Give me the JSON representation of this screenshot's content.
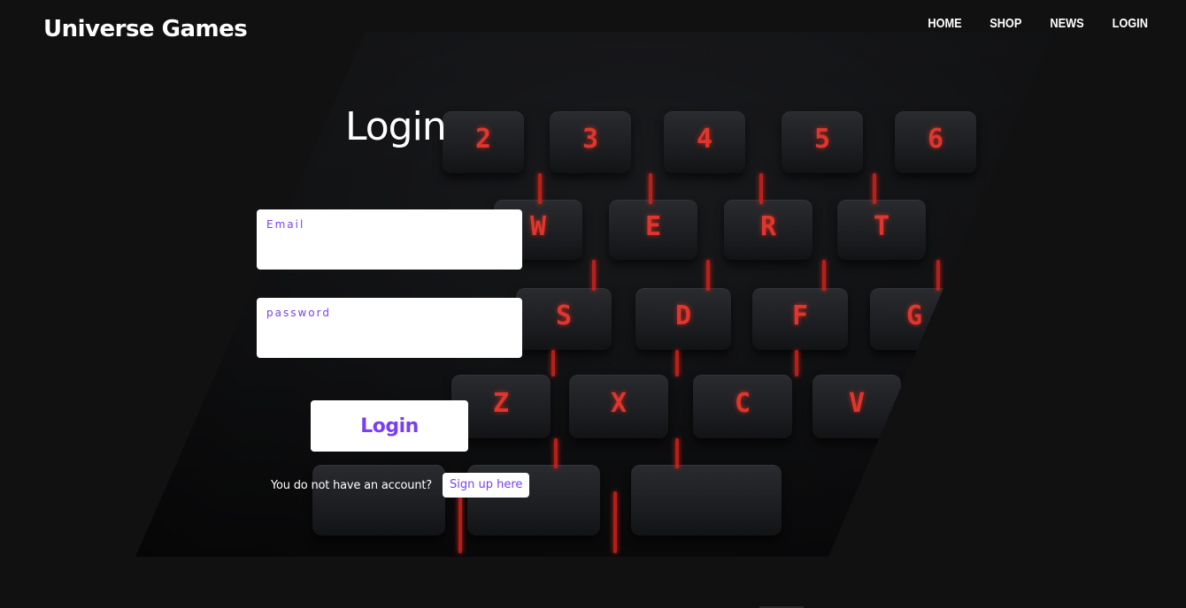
{
  "header": {
    "logo": "Universe Games",
    "nav": [
      {
        "label": "HOME"
      },
      {
        "label": "SHOP"
      },
      {
        "label": "NEWS"
      },
      {
        "label": "LOGIN"
      }
    ]
  },
  "hero": {
    "background_image": "red-backlit-keyboard",
    "key_legends": [
      "2",
      "3",
      "4",
      "5",
      "6",
      "W",
      "E",
      "R",
      "T",
      "S",
      "D",
      "F",
      "G",
      "Z",
      "X",
      "C",
      "V"
    ]
  },
  "login": {
    "title": "Login",
    "email": {
      "label": "Email",
      "value": ""
    },
    "password": {
      "label": "password",
      "value": ""
    },
    "submit_label": "Login",
    "signup_prompt": "You do not have an account?",
    "signup_link": "Sign up here"
  },
  "colors": {
    "background": "#111111",
    "accent": "#7a3ff0",
    "key_glow": "#ff3b2f",
    "text": "#ffffff"
  }
}
